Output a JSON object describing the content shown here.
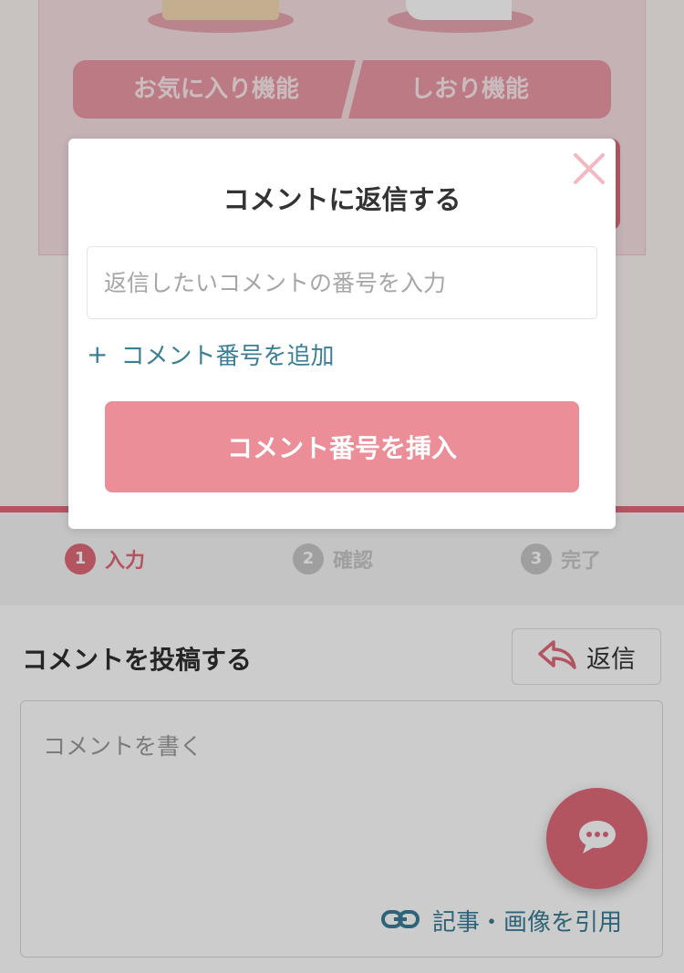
{
  "promo": {
    "features": [
      {
        "label": "お気に入り機能"
      },
      {
        "label": "しおり機能"
      }
    ]
  },
  "steps": [
    {
      "number": "1",
      "label": "入力",
      "active": true
    },
    {
      "number": "2",
      "label": "確認",
      "active": false
    },
    {
      "number": "3",
      "label": "完了",
      "active": false
    }
  ],
  "comment_form": {
    "heading": "コメントを投稿する",
    "reply_button_label": "返信",
    "textarea_placeholder": "コメントを書く",
    "quote_link_label": "記事・画像を引用"
  },
  "modal": {
    "title": "コメントに返信する",
    "input_placeholder": "返信したいコメントの番号を入力",
    "add_number_plus": "+",
    "add_number_label": "コメント番号を追加",
    "insert_button_label": "コメント番号を挿入"
  },
  "colors": {
    "accent": "#e0697a",
    "button_pink": "#ec8e98",
    "link_teal": "#3b7e96",
    "step_inactive": "#c7c7c7"
  },
  "icons": {
    "close": "close-icon",
    "reply": "reply-arrow-icon",
    "link": "link-icon",
    "chat": "chat-bubble-icon"
  }
}
